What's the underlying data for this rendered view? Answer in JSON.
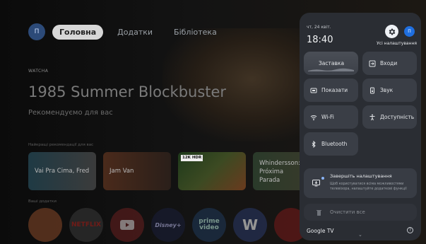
{
  "background": {
    "profile_initial": "П",
    "nav": {
      "home": "Головна",
      "apps": "Додатки",
      "library": "Бібліотека"
    },
    "brand": "WATCHA",
    "hero_title": "1985 Summer Blockbuster",
    "hero_subtitle": "Рекомендуємо для вас",
    "row1_label": "Найкращі рекомендації для вас",
    "cards": [
      "Vai Pra Cima, Fred",
      "Jam Van",
      "",
      "Whindersson: Próxima Parada"
    ],
    "card_badge": "12K HDR",
    "row2_label": "Ваші додатки",
    "apps": [
      "",
      "NETFLIX",
      "",
      "Disney+",
      "prime video",
      "W",
      ""
    ]
  },
  "panel": {
    "date": "чт, 24 квіт.",
    "time": "18:40",
    "settings_label": "Усі налаштування",
    "avatar_initial": "П",
    "tiles": {
      "screensaver": "Заставка",
      "inputs": "Входи",
      "display": "Показати",
      "sound": "Звук",
      "wifi": "Wi-Fi",
      "accessibility": "Доступність",
      "bluetooth": "Bluetooth"
    },
    "notification": {
      "title": "Завершіть налаштування",
      "body": "Щоб користуватися всіма можливостями телевізора, налаштуйте додаткові функції"
    },
    "clear_all": "Очистити все",
    "footer_brand": "Google TV"
  },
  "colors": {
    "panel": "#2a2d33",
    "tile": "#3a3e46",
    "accent": "#1f6fe0"
  }
}
